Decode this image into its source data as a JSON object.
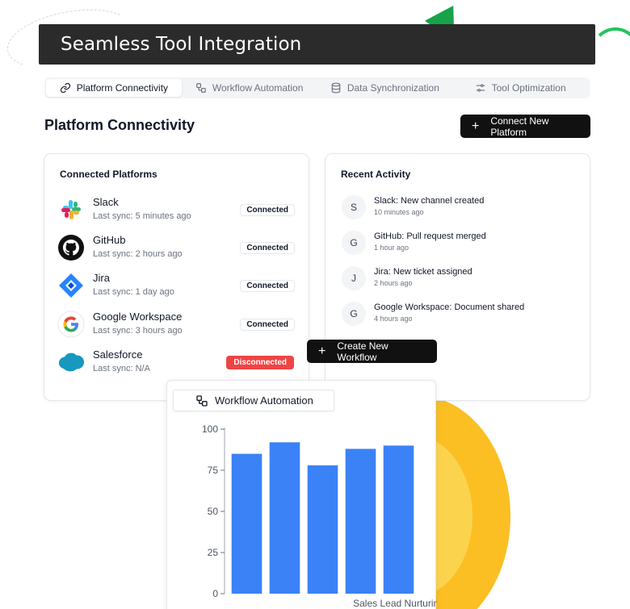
{
  "header": {
    "title": "Seamless Tool Integration"
  },
  "tabs": [
    {
      "label": "Platform Connectivity",
      "icon": "link-icon",
      "active": true
    },
    {
      "label": "Workflow Automation",
      "icon": "workflow-icon",
      "active": false
    },
    {
      "label": "Data Synchronization",
      "icon": "database-icon",
      "active": false
    },
    {
      "label": "Tool Optimization",
      "icon": "sliders-icon",
      "active": false
    }
  ],
  "section": {
    "title": "Platform Connectivity",
    "connect_button": "Connect New Platform"
  },
  "platforms": {
    "title": "Connected Platforms",
    "items": [
      {
        "name": "Slack",
        "sync": "Last sync: 5 minutes ago",
        "status": "Connected",
        "icon": "slack-icon"
      },
      {
        "name": "GitHub",
        "sync": "Last sync: 2 hours ago",
        "status": "Connected",
        "icon": "github-icon"
      },
      {
        "name": "Jira",
        "sync": "Last sync: 1 day ago",
        "status": "Connected",
        "icon": "jira-icon"
      },
      {
        "name": "Google Workspace",
        "sync": "Last sync: 3 hours ago",
        "status": "Connected",
        "icon": "google-icon"
      },
      {
        "name": "Salesforce",
        "sync": "Last sync: N/A",
        "status": "Disconnected",
        "icon": "salesforce-icon"
      }
    ]
  },
  "activity": {
    "title": "Recent Activity",
    "items": [
      {
        "initial": "S",
        "text": "Slack: New channel created",
        "time": "10 minutes ago"
      },
      {
        "initial": "G",
        "text": "GitHub: Pull request merged",
        "time": "1 hour ago"
      },
      {
        "initial": "J",
        "text": "Jira: New ticket assigned",
        "time": "2 hours ago"
      },
      {
        "initial": "G",
        "text": "Google Workspace: Document shared",
        "time": "4 hours ago"
      }
    ]
  },
  "workflow_button": "Create New Workflow",
  "chart_panel": {
    "tab_label": "Workflow Automation"
  },
  "chart_data": {
    "type": "bar",
    "categories": [
      "",
      "",
      "",
      "",
      "Sales Lead Nurturing"
    ],
    "values": [
      85,
      92,
      78,
      88,
      90
    ],
    "ylim": [
      0,
      100
    ],
    "yticks": [
      0,
      25,
      50,
      75,
      100
    ],
    "bar_color": "#3b82f6"
  },
  "colors": {
    "accent": "#111111",
    "danger": "#ef4444",
    "bar": "#3b82f6",
    "header": "#2b2b2b"
  }
}
